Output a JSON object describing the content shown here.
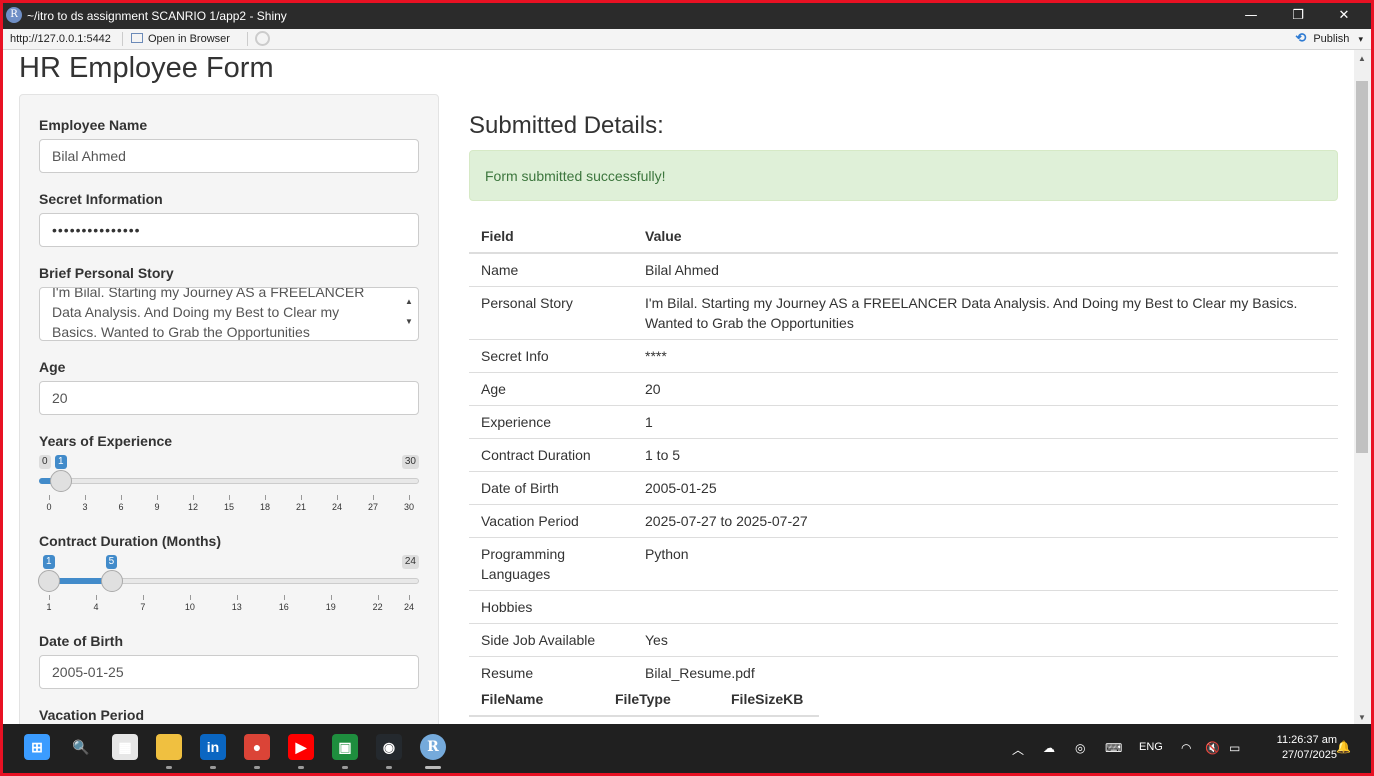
{
  "window": {
    "title": "~/itro to ds assignment SCANRIO 1/app2 - Shiny",
    "minimize": "—",
    "maximize": "❐",
    "close": "✕"
  },
  "addressbar": {
    "url": "http://127.0.0.1:5442",
    "open_browser": "Open in Browser",
    "publish": "Publish",
    "publish_caret": "▾"
  },
  "page": {
    "title": "HR Employee Form"
  },
  "form": {
    "employee_name": {
      "label": "Employee Name",
      "value": "Bilal Ahmed"
    },
    "secret": {
      "label": "Secret Information",
      "value": "•••••••••••••••"
    },
    "story": {
      "label": "Brief Personal Story",
      "line1": "I'm Bilal. Starting my Journey AS a FREELANCER",
      "line2": "Data Analysis. And Doing my Best to Clear my",
      "line3": "Basics. Wanted to Grab the Opportunities"
    },
    "age": {
      "label": "Age",
      "value": "20"
    },
    "experience": {
      "label": "Years of Experience",
      "min": "0",
      "max": "30",
      "value": "1",
      "value_num": 1,
      "range": [
        0,
        30
      ],
      "ticks": [
        "0",
        "3",
        "6",
        "9",
        "12",
        "15",
        "18",
        "21",
        "24",
        "27",
        "30"
      ]
    },
    "contract": {
      "label": "Contract Duration (Months)",
      "min": "1",
      "max": "24",
      "low": "1",
      "high": "5",
      "low_num": 1,
      "high_num": 5,
      "range": [
        1,
        24
      ],
      "ticks": [
        "1",
        "4",
        "7",
        "10",
        "13",
        "16",
        "19",
        "22",
        "24"
      ]
    },
    "dob": {
      "label": "Date of Birth",
      "value": "2005-01-25"
    },
    "vacation": {
      "label": "Vacation Period"
    }
  },
  "details": {
    "heading": "Submitted Details:",
    "alert": "Form submitted successfully!",
    "columns": [
      "Field",
      "Value"
    ],
    "rows": [
      {
        "field": "Name",
        "value": "Bilal Ahmed"
      },
      {
        "field": "Personal Story",
        "value": "I'm Bilal. Starting my Journey AS a FREELANCER Data Analysis. And Doing my Best to Clear my Basics. Wanted to Grab the Opportunities"
      },
      {
        "field": "Secret Info",
        "value": "****"
      },
      {
        "field": "Age",
        "value": "20"
      },
      {
        "field": "Experience",
        "value": "1"
      },
      {
        "field": "Contract Duration",
        "value": "1 to 5"
      },
      {
        "field": "Date of Birth",
        "value": "2005-01-25"
      },
      {
        "field": "Vacation Period",
        "value": "2025-07-27 to 2025-07-27"
      },
      {
        "field": "Programming Languages",
        "value": "Python"
      },
      {
        "field": "Hobbies",
        "value": ""
      },
      {
        "field": "Side Job Available",
        "value": "Yes"
      },
      {
        "field": "Resume",
        "value": "Bilal_Resume.pdf"
      }
    ],
    "file_columns": [
      "FileName",
      "FileType",
      "FileSizeKB"
    ]
  },
  "taskbar": {
    "apps": [
      {
        "name": "start-icon",
        "glyph": "⊞",
        "color": "#3b9cff"
      },
      {
        "name": "search-icon",
        "glyph": "🔍",
        "color": "transparent"
      },
      {
        "name": "store-icon",
        "glyph": "▦",
        "color": "#e6e6e6"
      },
      {
        "name": "file-explorer-icon",
        "glyph": "",
        "color": "#f0c040"
      },
      {
        "name": "linkedin-icon",
        "glyph": "in",
        "color": "#0a66c2"
      },
      {
        "name": "chrome-icon",
        "glyph": "●",
        "color": "#db4437"
      },
      {
        "name": "youtube-icon",
        "glyph": "▶",
        "color": "#ff0000"
      },
      {
        "name": "classroom-icon",
        "glyph": "▣",
        "color": "#1e8e3e"
      },
      {
        "name": "github-icon",
        "glyph": "◉",
        "color": "#24292e"
      },
      {
        "name": "rstudio-icon",
        "glyph": "R",
        "color": "#75aadb"
      }
    ],
    "lang": "ENG",
    "time": "11:26:37 am",
    "date": "27/07/2025"
  }
}
